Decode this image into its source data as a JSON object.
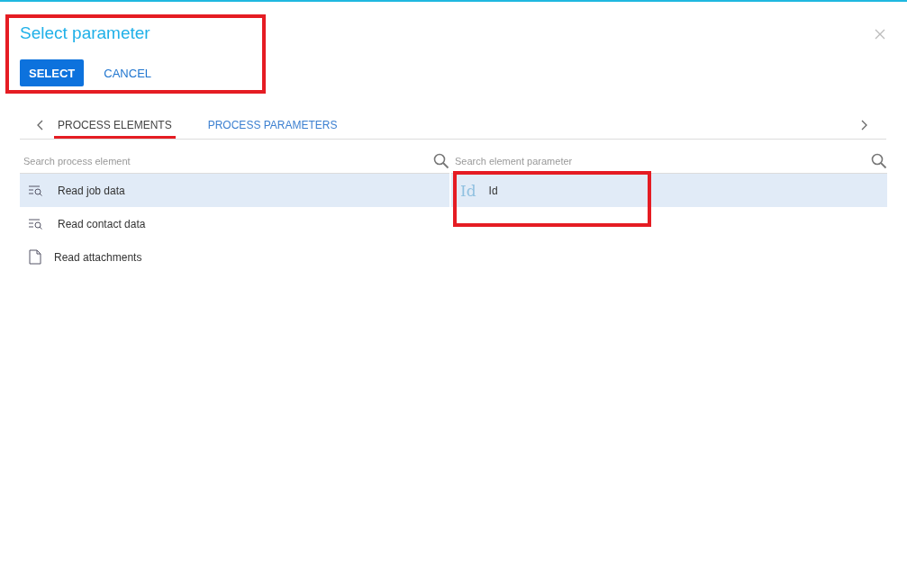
{
  "dialog": {
    "title": "Select parameter",
    "highlighted": true
  },
  "buttons": [
    {
      "label": "SELECT",
      "kind": "primary"
    },
    {
      "label": "CANCEL",
      "kind": "link"
    }
  ],
  "tabs": [
    {
      "label": "PROCESS ELEMENTS",
      "selected": true
    },
    {
      "label": "PROCESS PARAMETERS",
      "selected": false
    }
  ],
  "elements": {
    "search": {
      "placeholder": "Search process element"
    },
    "items": [
      {
        "label": "Read job data",
        "kind": "read",
        "selected": true
      },
      {
        "label": "Read contact data",
        "kind": "read",
        "selected": false
      },
      {
        "label": "Read attachments",
        "kind": "file",
        "selected": false
      }
    ]
  },
  "parameters": {
    "search": {
      "placeholder": "Search element parameter"
    },
    "items": [
      {
        "type_glyph": "Id",
        "label": "Id",
        "selected": true,
        "highlighted": true
      }
    ]
  }
}
